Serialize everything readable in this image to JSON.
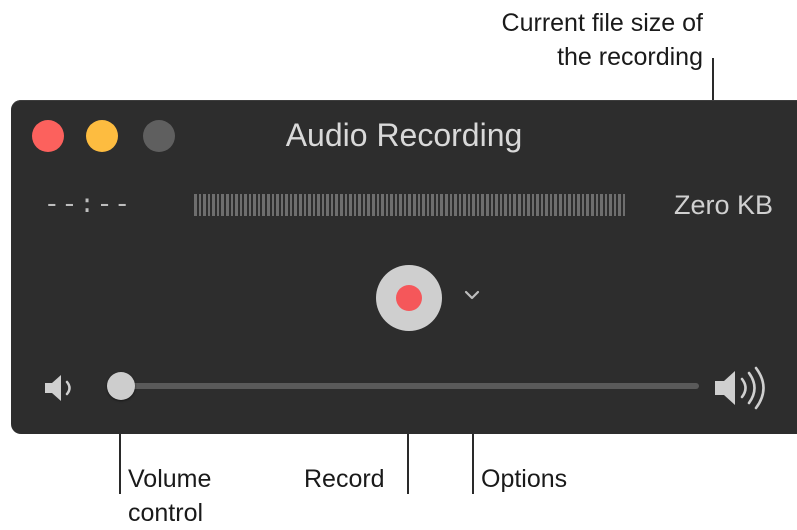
{
  "window": {
    "title": "Audio Recording",
    "elapsed_time": "--:--",
    "file_size": "Zero KB",
    "level_meter_segments": 95,
    "volume_level": 0.0
  },
  "callouts": {
    "file_size": "Current file size of\nthe recording",
    "volume": "Volume\ncontrol",
    "record": "Record",
    "options": "Options"
  },
  "icons": {
    "close": "close-button",
    "minimize": "minimize-button",
    "zoom": "zoom-button",
    "record": "record-dot-icon",
    "options": "chevron-down-icon",
    "volume_low": "speaker-low-icon",
    "volume_high": "speaker-high-icon"
  },
  "colors": {
    "window_bg": "#2d2d2d",
    "close": "#fc615d",
    "minimize": "#fdbc40",
    "zoom": "#5f5f5f",
    "record": "#f5575a",
    "record_button": "#cfcfcf"
  }
}
